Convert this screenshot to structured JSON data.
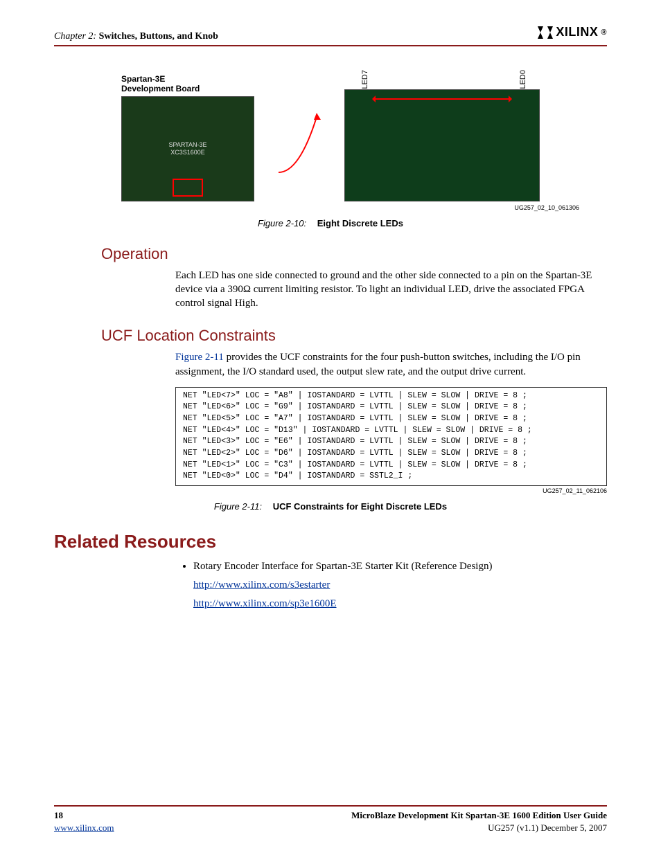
{
  "header": {
    "chapter_prefix": "Chapter 2:",
    "chapter_title": "Switches, Buttons, and Knob",
    "logo_text": "XILINX",
    "logo_reg": "®"
  },
  "figure_top": {
    "board_label_l1": "Spartan-3E",
    "board_label_l2": "Development Board",
    "led7": "LED7",
    "led0": "LED0",
    "id": "UG257_02_10_061306",
    "caption_num": "Figure 2-10:",
    "caption_title": "Eight Discrete LEDs"
  },
  "sections": {
    "operation": {
      "title": "Operation",
      "body": "Each LED has one side connected to ground and the other side connected to a pin on the Spartan-3E device via a 390Ω current limiting resistor. To light an individual LED, drive the associated FPGA control signal High."
    },
    "ucf": {
      "title": "UCF Location Constraints",
      "body_pre": "Figure 2-11",
      "body_post": " provides the UCF constraints for the four push-button switches, including the I/O pin assignment, the I/O standard used, the output slew rate, and the output drive current."
    },
    "related": {
      "title": "Related Resources",
      "item1": "Rotary Encoder Interface for Spartan-3E Starter Kit (Reference Design)",
      "link1": "http://www.xilinx.com/s3estarter",
      "link2": "http://www.xilinx.com/sp3e1600E"
    }
  },
  "code": {
    "l1": "NET \"LED<7>\" LOC = \"A8\"  | IOSTANDARD = LVTTL | SLEW = SLOW | DRIVE = 8 ;",
    "l2": "NET \"LED<6>\" LOC = \"G9\"  | IOSTANDARD = LVTTL | SLEW = SLOW | DRIVE = 8 ;",
    "l3": "NET \"LED<5>\" LOC = \"A7\"  | IOSTANDARD = LVTTL | SLEW = SLOW | DRIVE = 8 ;",
    "l4": " NET \"LED<4>\" LOC = \"D13\" | IOSTANDARD = LVTTL | SLEW = SLOW | DRIVE = 8 ;",
    "l5": "NET \"LED<3>\" LOC = \"E6\"  | IOSTANDARD = LVTTL | SLEW = SLOW | DRIVE = 8 ;",
    "l6": "NET \"LED<2>\" LOC = \"D6\"  | IOSTANDARD = LVTTL | SLEW = SLOW | DRIVE = 8 ;",
    "l7": "NET \"LED<1>\" LOC = \"C3\"  | IOSTANDARD = LVTTL | SLEW = SLOW | DRIVE = 8 ;",
    "l8": "NET \"LED<0>\" LOC = \"D4\"  | IOSTANDARD = SSTL2_I ;",
    "id": "UG257_02_11_062106",
    "caption_num": "Figure 2-11:",
    "caption_title": "UCF Constraints for Eight Discrete LEDs"
  },
  "footer": {
    "page": "18",
    "url": "www.xilinx.com",
    "title": "MicroBlaze Development Kit Spartan-3E 1600 Edition User Guide",
    "docid": "UG257 (v1.1) December 5, 2007"
  }
}
